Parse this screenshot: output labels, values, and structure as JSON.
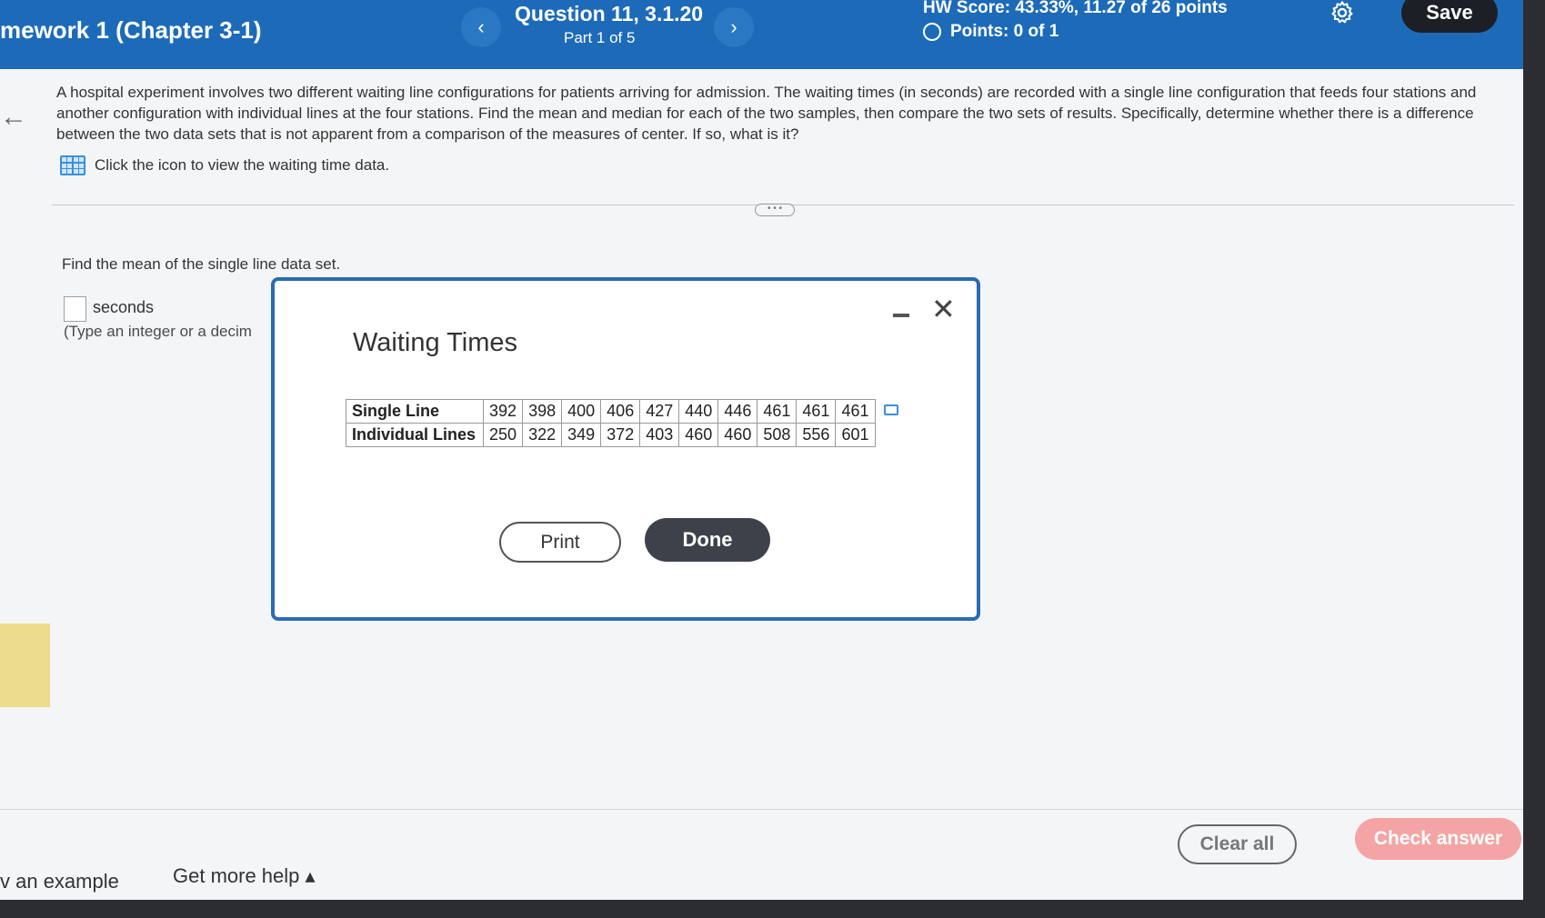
{
  "header": {
    "assignment_title": "mework 1 (Chapter 3-1)",
    "question_title": "Question 11, 3.1.20",
    "part": "Part 1 of 5",
    "hw_score": "HW Score: 43.33%, 11.27 of 26 points",
    "points": "Points: 0 of 1",
    "prev_label": "‹",
    "next_label": "›",
    "save_label": "Save"
  },
  "question": {
    "text": "A hospital experiment involves two different waiting line configurations for patients arriving for admission. The waiting times (in seconds) are recorded with a single line configuration that feeds four stations and another configuration with individual lines at the four stations. Find the mean and median for each of the two samples, then compare the two sets of results. Specifically, determine whether there is a difference between the two data sets that is not apparent from a comparison of the measures of center. If so, what is it?",
    "data_link": "Click the icon to view the waiting time data.",
    "expand_label": "• • •"
  },
  "part": {
    "prompt": "Find the mean of the single line data set.",
    "unit": "seconds",
    "hint": "(Type an integer or a decim"
  },
  "footer": {
    "example": "v an example",
    "help": "Get more help ▴",
    "clear_label": "Clear all",
    "check_label": "Check answer"
  },
  "dialog": {
    "title": "Waiting Times",
    "rows": [
      {
        "label": "Single Line",
        "values": [
          "392",
          "398",
          "400",
          "406",
          "427",
          "440",
          "446",
          "461",
          "461",
          "461"
        ]
      },
      {
        "label": "Individual Lines",
        "values": [
          "250",
          "322",
          "349",
          "372",
          "403",
          "460",
          "460",
          "508",
          "556",
          "601"
        ]
      }
    ],
    "close_label": "✕",
    "print_label": "Print",
    "done_label": "Done"
  }
}
